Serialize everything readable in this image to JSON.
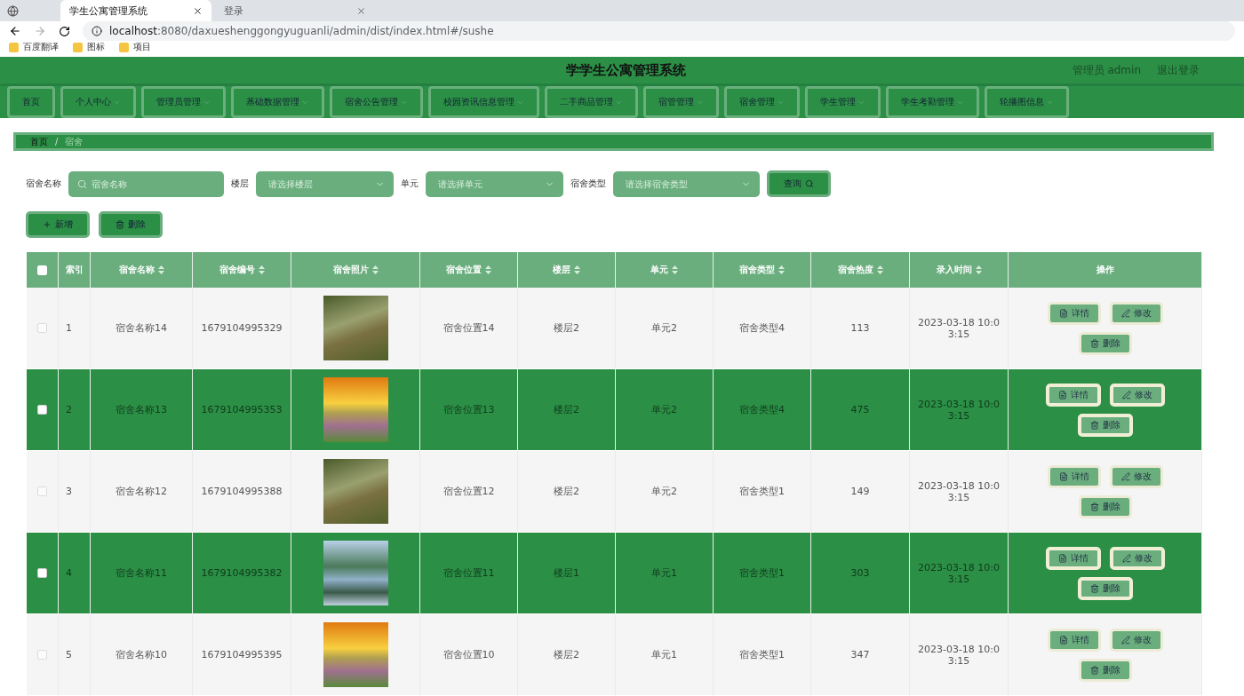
{
  "browser": {
    "tabs": [
      {
        "label": "学生公寓管理系统",
        "selected": true
      },
      {
        "label": "登录",
        "selected": false
      }
    ],
    "url_host": "localhost",
    "url_rest": ":8080/daxueshenggongyuguanli/admin/dist/index.html#/sushe",
    "bookmarks": [
      "百度翻译",
      "图标",
      "项目"
    ]
  },
  "header": {
    "title": "学学生公寓管理系统",
    "user": "管理员 admin",
    "logout": "退出登录"
  },
  "nav": [
    {
      "label": "首页",
      "dropdown": false
    },
    {
      "label": "个人中心",
      "dropdown": true
    },
    {
      "label": "管理员管理",
      "dropdown": true
    },
    {
      "label": "基础数据管理",
      "dropdown": true
    },
    {
      "label": "宿舍公告管理",
      "dropdown": true
    },
    {
      "label": "校园资讯信息管理",
      "dropdown": true
    },
    {
      "label": "二手商品管理",
      "dropdown": true
    },
    {
      "label": "宿管管理",
      "dropdown": true
    },
    {
      "label": "宿舍管理",
      "dropdown": true
    },
    {
      "label": "学生管理",
      "dropdown": true
    },
    {
      "label": "学生考勤管理",
      "dropdown": true
    },
    {
      "label": "轮播图信息",
      "dropdown": true
    }
  ],
  "breadcrumb": {
    "items": [
      "首页",
      "宿舍"
    ],
    "separator": "/"
  },
  "filters": [
    {
      "label": "宿舍名称",
      "kind": "search",
      "placeholder": "宿舍名称"
    },
    {
      "label": "楼层",
      "kind": "select",
      "placeholder": "请选择楼层"
    },
    {
      "label": "单元",
      "kind": "select",
      "placeholder": "请选择单元"
    },
    {
      "label": "宿舍类型",
      "kind": "select",
      "placeholder": "请选择宿舍类型"
    }
  ],
  "query_button": "查询",
  "add_button": "新增",
  "delete_button": "删除",
  "table": {
    "all_checked": false,
    "columns": [
      "索引",
      "宿舍名称",
      "宿舍编号",
      "宿舍照片",
      "宿舍位置",
      "楼层",
      "单元",
      "宿舍类型",
      "宿舍热度",
      "录入时间",
      "操作"
    ],
    "rows": [
      {
        "highlighted": false,
        "checked": false,
        "cells": [
          "1",
          "宿舍名称14",
          "1679104995329",
          null,
          "宿舍位置14",
          "楼层2",
          "单元2",
          "宿舍类型4",
          "113",
          "2023-03-18 10:03:15"
        ],
        "actions": [
          "详情",
          "修改",
          "删除"
        ]
      },
      {
        "highlighted": true,
        "checked": false,
        "cells": [
          "2",
          "宿舍名称13",
          "1679104995353",
          null,
          "宿舍位置13",
          "楼层2",
          "单元2",
          "宿舍类型4",
          "475",
          "2023-03-18 10:03:15"
        ],
        "actions": [
          "详情",
          "修改",
          "删除"
        ]
      },
      {
        "highlighted": false,
        "checked": false,
        "cells": [
          "3",
          "宿舍名称12",
          "1679104995388",
          null,
          "宿舍位置12",
          "楼层2",
          "单元2",
          "宿舍类型1",
          "149",
          "2023-03-18 10:03:15"
        ],
        "actions": [
          "详情",
          "修改",
          "删除"
        ]
      },
      {
        "highlighted": true,
        "checked": false,
        "cells": [
          "4",
          "宿舍名称11",
          "1679104995382",
          null,
          "宿舍位置11",
          "楼层1",
          "单元1",
          "宿舍类型1",
          "303",
          "2023-03-18 10:03:15"
        ],
        "actions": [
          "详情",
          "修改",
          "删除"
        ]
      },
      {
        "highlighted": false,
        "checked": false,
        "cells": [
          "5",
          "宿舍名称10",
          "1679104995395",
          null,
          "宿舍位置10",
          "楼层2",
          "单元1",
          "宿舍类型1",
          "347",
          "2023-03-18 10:03:15"
        ],
        "actions": [
          "详情",
          "修改",
          "删除"
        ]
      }
    ]
  }
}
